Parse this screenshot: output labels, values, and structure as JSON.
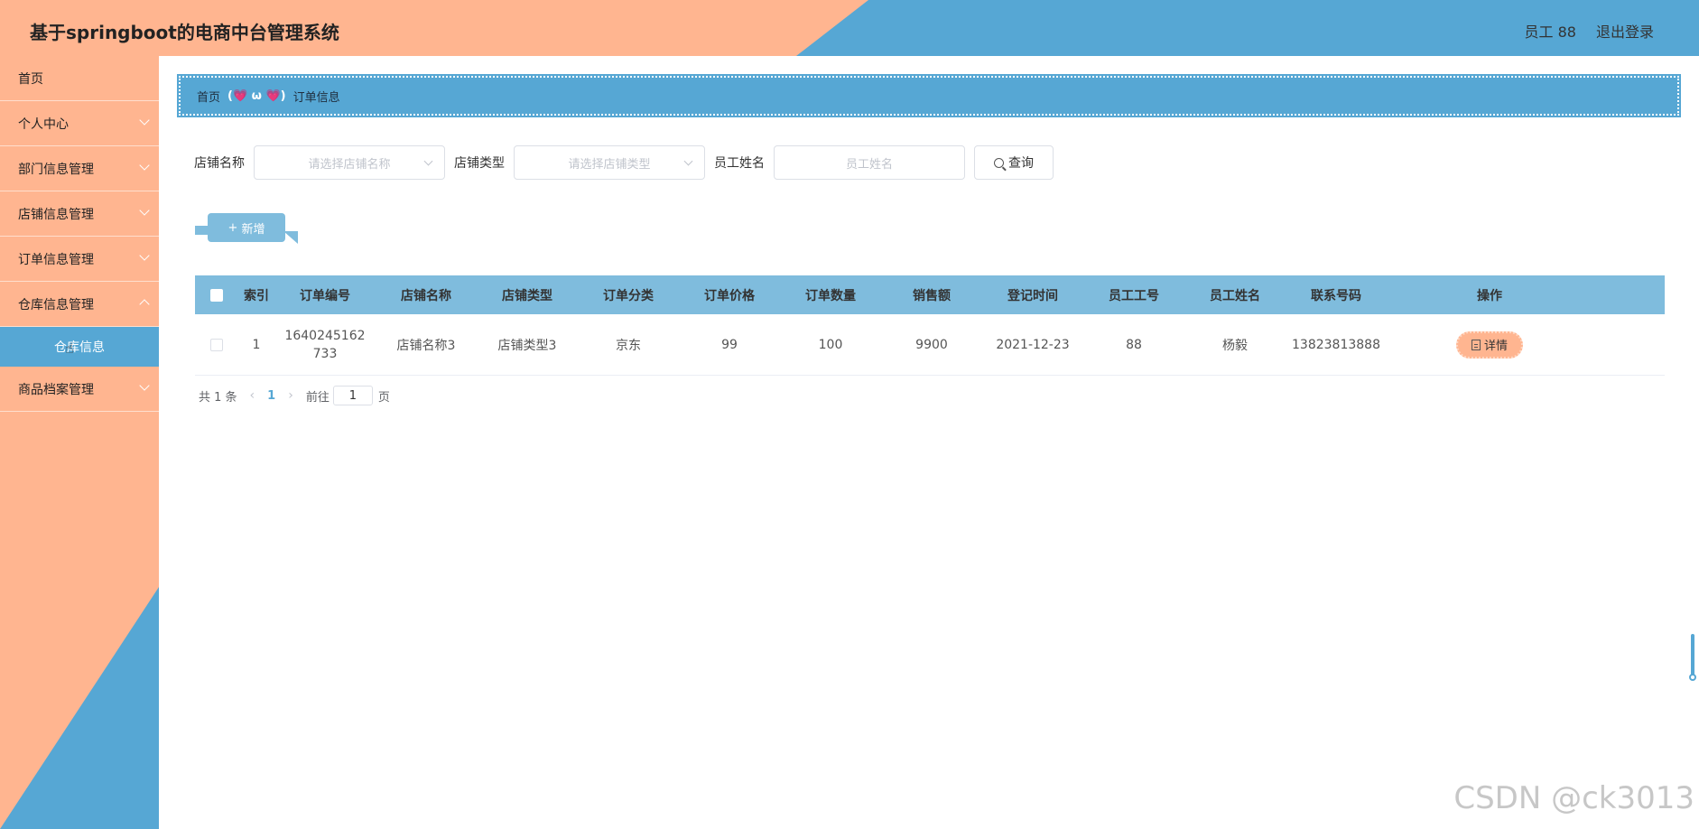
{
  "header": {
    "title": "基于springboot的电商中台管理系统",
    "user": "员工 88",
    "logout": "退出登录"
  },
  "sidebar": {
    "items": [
      {
        "label": "首页"
      },
      {
        "label": "个人中心"
      },
      {
        "label": "部门信息管理"
      },
      {
        "label": "店铺信息管理"
      },
      {
        "label": "订单信息管理"
      },
      {
        "label": "仓库信息管理"
      },
      {
        "label": "商品档案管理"
      }
    ],
    "active_sub": "仓库信息"
  },
  "breadcrumb": {
    "home": "首页",
    "separator": "(💗 ω 💗)",
    "current": "订单信息"
  },
  "search": {
    "shop_name_label": "店铺名称",
    "shop_name_placeholder": "请选择店铺名称",
    "shop_type_label": "店铺类型",
    "shop_type_placeholder": "请选择店铺类型",
    "staff_name_label": "员工姓名",
    "staff_name_placeholder": "员工姓名",
    "query_button": "查询"
  },
  "toolbar": {
    "add_label": "新增"
  },
  "table": {
    "headers": [
      "索引",
      "订单编号",
      "店铺名称",
      "店铺类型",
      "订单分类",
      "订单价格",
      "订单数量",
      "销售额",
      "登记时间",
      "员工工号",
      "员工姓名",
      "联系号码",
      "操作"
    ],
    "rows": [
      {
        "index": "1",
        "order_no": "1640245162733",
        "shop_name": "店铺名称3",
        "shop_type": "店铺类型3",
        "category": "京东",
        "price": "99",
        "quantity": "100",
        "sales": "9900",
        "date": "2021-12-23",
        "staff_id": "88",
        "staff_name": "杨毅",
        "phone": "13823813888",
        "action": "详情"
      }
    ]
  },
  "pagination": {
    "total": "共 1 条",
    "current_page": "1",
    "goto_label": "前往",
    "goto_value": "1",
    "page_suffix": "页"
  },
  "watermark": "CSDN @ck3013",
  "colors": {
    "peach": "#ffb590",
    "blue": "#56a7d4",
    "table_head": "#7fbcdd"
  }
}
